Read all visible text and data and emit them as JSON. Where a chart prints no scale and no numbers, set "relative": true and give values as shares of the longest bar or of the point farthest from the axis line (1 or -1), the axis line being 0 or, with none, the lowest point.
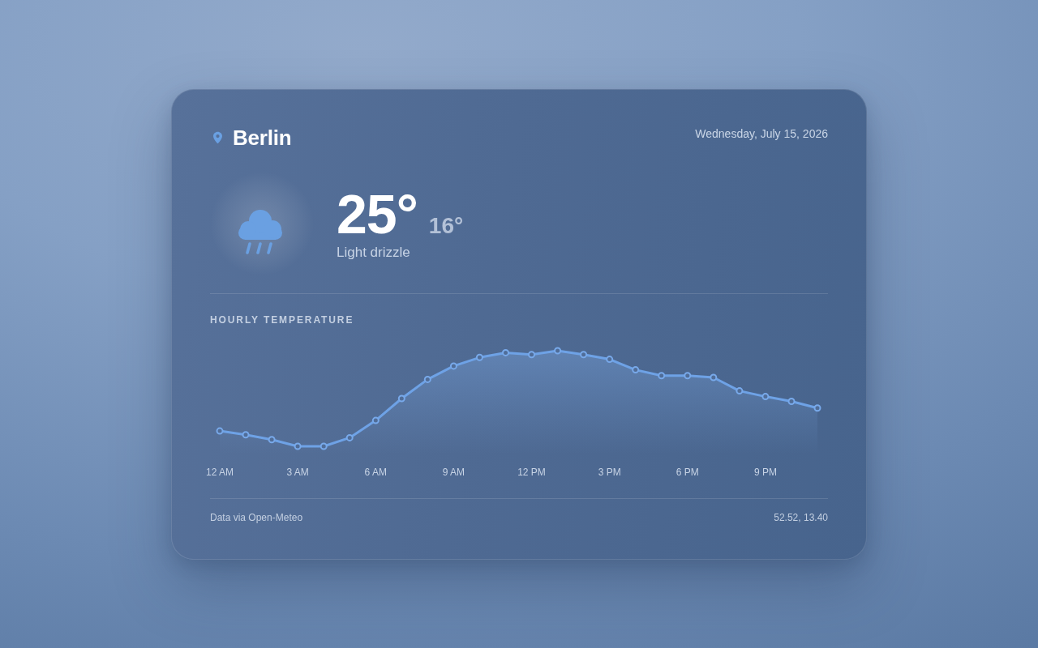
{
  "location": {
    "city": "Berlin"
  },
  "date": "Wednesday, July 15, 2026",
  "current": {
    "high": "25°",
    "low": "16°",
    "condition": "Light drizzle"
  },
  "hourly": {
    "title": "HOURLY TEMPERATURE",
    "chart_data": {
      "type": "area",
      "relative": true,
      "marker": "circle",
      "categories": [
        "12 AM",
        null,
        null,
        "3 AM",
        null,
        null,
        "6 AM",
        null,
        null,
        "9 AM",
        null,
        null,
        "12 PM",
        null,
        null,
        "3 PM",
        null,
        null,
        "6 PM",
        null,
        null,
        "9 PM",
        null,
        null
      ],
      "values": [
        0.16,
        0.12,
        0.07,
        0,
        0,
        0.09,
        0.27,
        0.5,
        0.7,
        0.84,
        0.93,
        0.98,
        0.96,
        1,
        0.96,
        0.91,
        0.8,
        0.74,
        0.74,
        0.72,
        0.58,
        0.52,
        0.47,
        0.4
      ]
    }
  },
  "footer": {
    "source": "Data via Open-Meteo",
    "coordinates": "52.52, 13.40"
  }
}
